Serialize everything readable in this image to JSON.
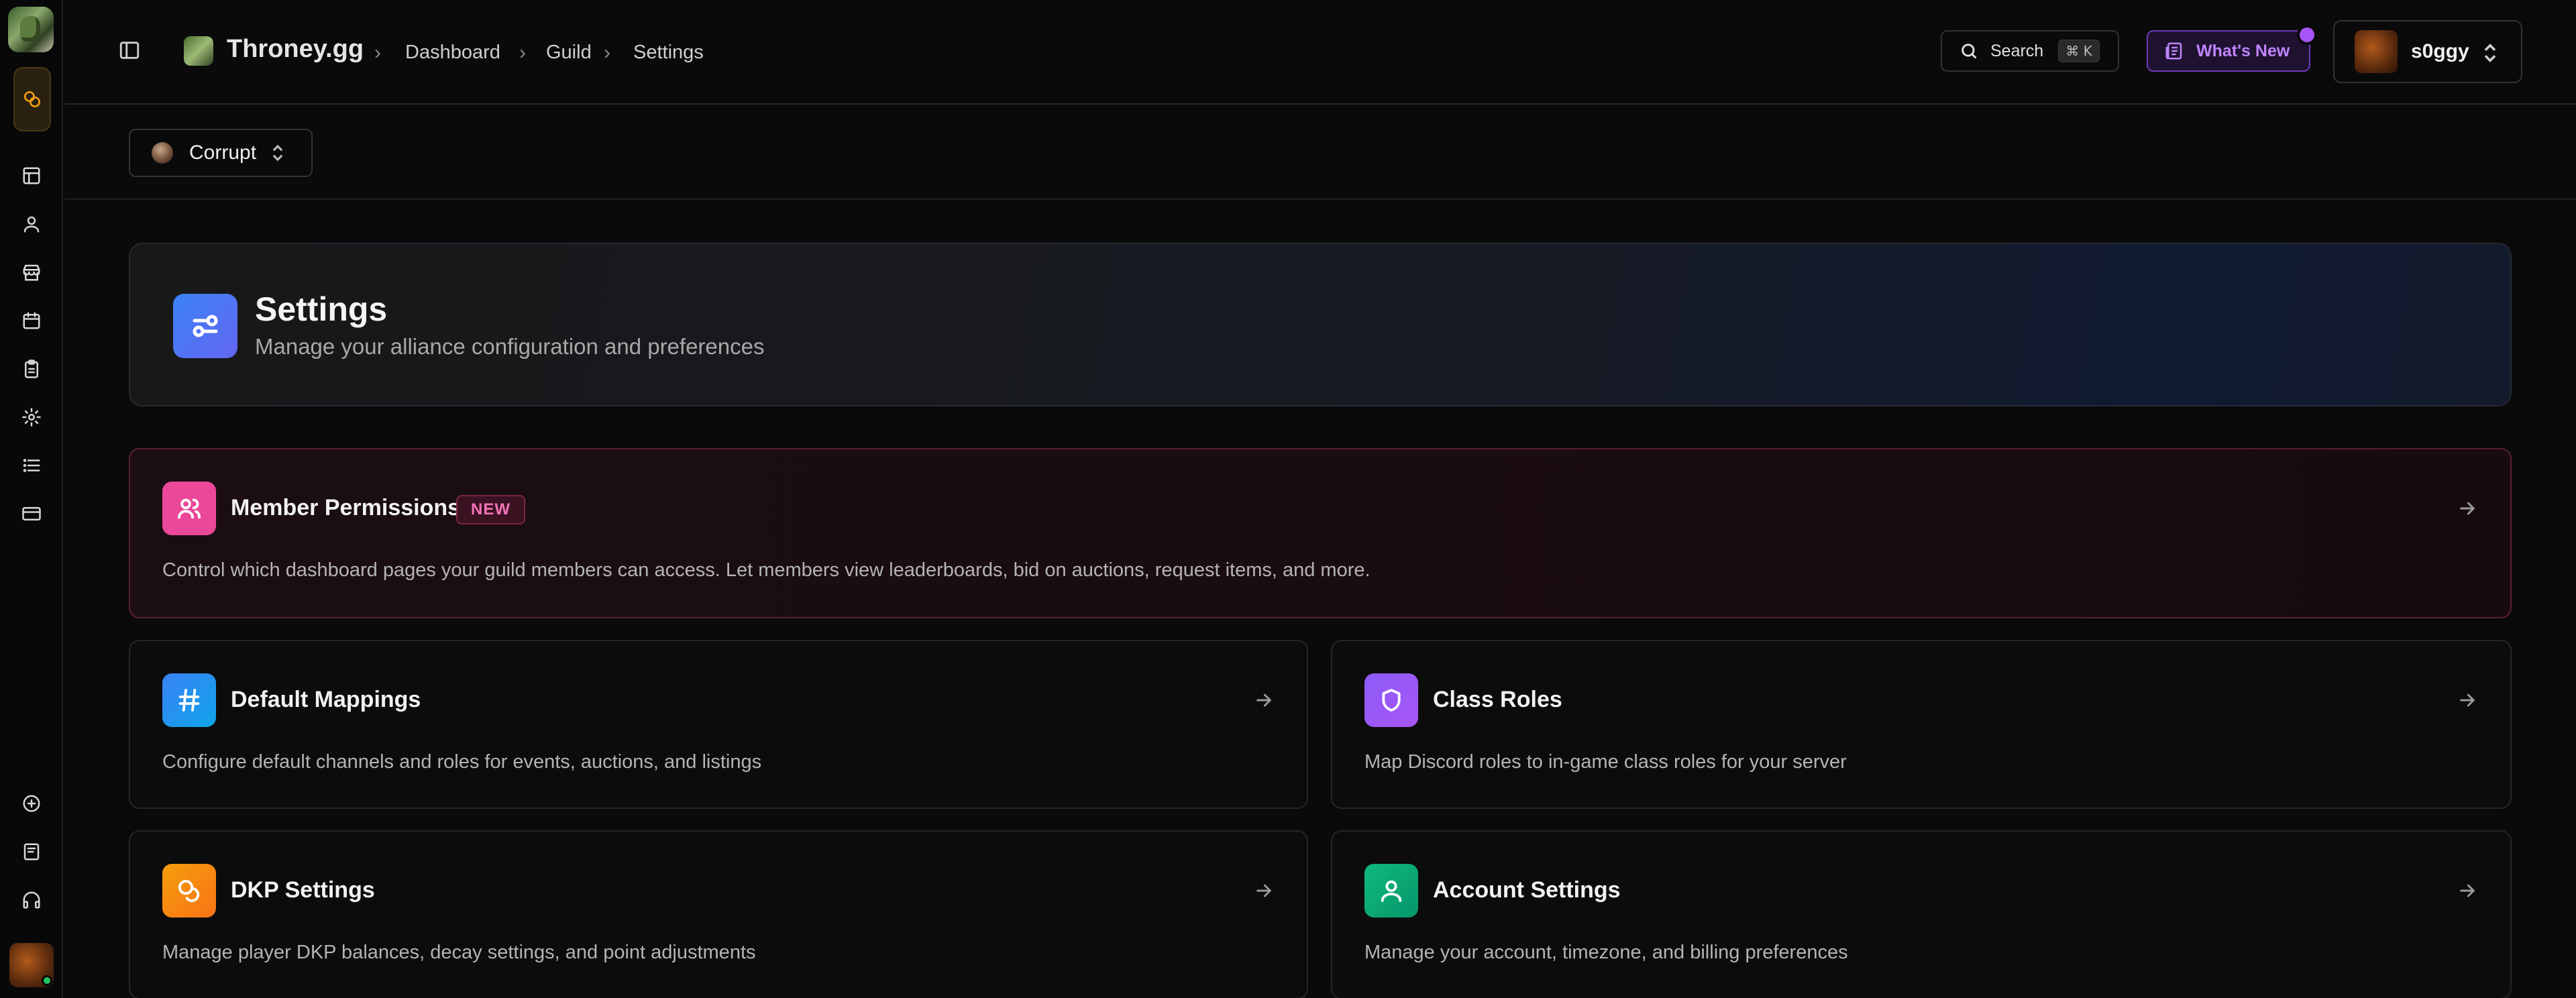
{
  "app": {
    "brand": "Throney.gg"
  },
  "breadcrumb": [
    "Dashboard",
    "Guild",
    "Settings"
  ],
  "search": {
    "label": "Search",
    "shortcut": "⌘ K"
  },
  "whats_new": {
    "label": "What's New"
  },
  "user": {
    "name": "s0ggy"
  },
  "guild_selector": {
    "label": "Corrupt"
  },
  "header": {
    "title": "Settings",
    "subtitle": "Manage your alliance configuration and preferences"
  },
  "cards": {
    "member_permissions": {
      "title": "Member Permissions",
      "badge": "NEW",
      "description": "Control which dashboard pages your guild members can access. Let members view leaderboards, bid on auctions, request items, and more."
    },
    "default_mappings": {
      "title": "Default Mappings",
      "description": "Configure default channels and roles for events, auctions, and listings"
    },
    "class_roles": {
      "title": "Class Roles",
      "description": "Map Discord roles to in-game class roles for your server"
    },
    "dkp_settings": {
      "title": "DKP Settings",
      "description": "Manage player DKP balances, decay settings, and point adjustments"
    },
    "account_settings": {
      "title": "Account Settings",
      "description": "Manage your account, timezone, and billing preferences"
    }
  },
  "colors": {
    "accent_purple": "#a855f7",
    "permissions_icon": "#ec4899",
    "mappings_icon": "#3b82f6",
    "class_roles_icon": "#8b5cf6",
    "dkp_icon": "#f59e0b",
    "account_icon": "#10b981",
    "online_status": "#22c55e"
  },
  "icons": {
    "rail": [
      "dashboard-icon",
      "user-icon",
      "store-icon",
      "calendar-icon",
      "clipboard-icon",
      "gear-icon",
      "list-icon",
      "credit-card-icon",
      "plus-circle-icon",
      "book-icon",
      "headphones-icon"
    ]
  }
}
